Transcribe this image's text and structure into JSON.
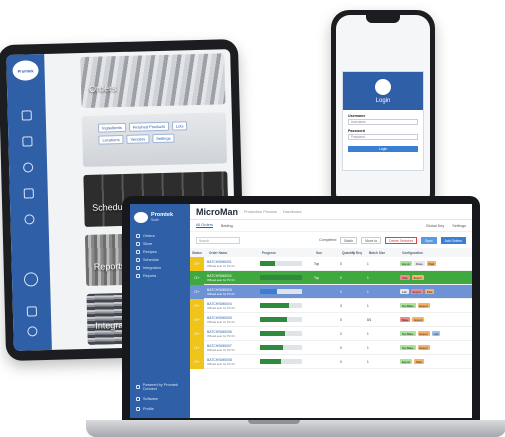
{
  "tablet": {
    "logo_text": "Promtek",
    "cards": [
      {
        "label": "Orders",
        "variant": "orders"
      },
      {
        "label": "",
        "variant": "products"
      },
      {
        "label": "Schedule",
        "variant": "schedule"
      },
      {
        "label": "Reports",
        "variant": "reports"
      },
      {
        "label": "Integrations",
        "variant": "integrations"
      }
    ],
    "product_chips": [
      "Ingredients",
      "Finished Products",
      "Lots",
      "Locations",
      "Vendors",
      "Settings"
    ],
    "side_icons": [
      "clipboard-icon",
      "list-icon",
      "layers-icon",
      "calendar-icon",
      "network-icon"
    ],
    "bottom_icons": [
      "logout-icon",
      "settings-icon"
    ]
  },
  "phone": {
    "login_title": "Login",
    "username_label": "Username",
    "username_placeholder": "Username",
    "password_label": "Password",
    "password_placeholder": "Password",
    "login_button": "Login"
  },
  "laptop": {
    "brand": "Promtek",
    "brand_sub": "Suite",
    "app_title": "MicroMan",
    "breadcrumb": [
      "Production Process",
      "Dashboard"
    ],
    "nav": [
      "Orders",
      "Store",
      "Recipes",
      "Schedule",
      "Integration",
      "Reports"
    ],
    "footer_nav": [
      "Powered by Promtek Connect",
      "Software",
      "Profile"
    ],
    "tabs": [
      "All Orders",
      "Batting"
    ],
    "tabs_right": [
      "Global Key",
      "Settings"
    ],
    "toolbar": {
      "search_placeholder": "Search",
      "filter_label": "Completed",
      "btn_batch": "Batch",
      "btn_move": "Move to",
      "btn_delete": "Delete Selected",
      "btn_sync": "Sync",
      "btn_add": "Add Orders"
    },
    "columns": [
      "Status",
      "Order Name",
      "Progress",
      "Sun",
      "Quantity",
      "% Req",
      "Batch Size",
      "Configuration"
    ],
    "rows": [
      {
        "status": "O+",
        "name": "BATCHSIM0001",
        "sub": "Offload auto for PU 01",
        "progress": 0.35,
        "row": "",
        "fill": "green",
        "tags": [
          "Export",
          "Rose",
          "Paid"
        ],
        "tagc": [
          "g",
          "w",
          "o"
        ],
        "sun": "Top",
        "qty": "0",
        "batch": "1"
      },
      {
        "status": "O+",
        "name": "BATCHSIM0002",
        "sub": "Offload auto for PU 01",
        "progress": 1.0,
        "row": "green",
        "fill": "green",
        "tags": [
          "Ship",
          "Export"
        ],
        "tagc": [
          "r",
          "o"
        ],
        "sun": "Top",
        "qty": "0",
        "batch": "1"
      },
      {
        "status": "O+",
        "name": "BATCHSIM0003",
        "sub": "Offload auto for PU 01",
        "progress": 0.4,
        "row": "blue",
        "fill": "blue",
        "tags": [
          "Lab",
          "Export",
          "Paid"
        ],
        "tagc": [
          "w",
          "r",
          "o"
        ],
        "sun": "",
        "qty": "0",
        "batch": "1"
      },
      {
        "status": "O+",
        "name": "BATCHSIM0004",
        "sub": "Offload auto for PU 01",
        "progress": 0.7,
        "row": "",
        "fill": "green",
        "tags": [
          "Not Bake",
          "Export"
        ],
        "tagc": [
          "g",
          "o"
        ],
        "sun": "",
        "qty": "3",
        "batch": "1"
      },
      {
        "status": "O+",
        "name": "BATCHSIM0005",
        "sub": "Offload auto for PU 01",
        "progress": 0.65,
        "row": "",
        "fill": "green",
        "tags": [
          "Bake",
          "Export"
        ],
        "tagc": [
          "r",
          "o"
        ],
        "sun": "",
        "qty": "0",
        "batch": "8/1"
      },
      {
        "status": "O+",
        "name": "BATCHSIM0006",
        "sub": "Offload auto for PU 01",
        "progress": 0.6,
        "row": "",
        "fill": "green",
        "tags": [
          "Not Bake",
          "Export",
          "Lab"
        ],
        "tagc": [
          "g",
          "o",
          "b"
        ],
        "sun": "",
        "qty": "2",
        "batch": "1"
      },
      {
        "status": "O+",
        "name": "BATCHSIM0007",
        "sub": "Offload auto for PU 01",
        "progress": 0.55,
        "row": "",
        "fill": "green",
        "tags": [
          "Not Bake",
          "Export"
        ],
        "tagc": [
          "g",
          "o"
        ],
        "sun": "",
        "qty": "0",
        "batch": "1"
      },
      {
        "status": "O+",
        "name": "BATCHSIM0008",
        "sub": "Offload auto for PU 01",
        "progress": 0.5,
        "row": "",
        "fill": "green",
        "tags": [
          "Export",
          "Paid"
        ],
        "tagc": [
          "g",
          "o"
        ],
        "sun": "",
        "qty": "0",
        "batch": "1"
      }
    ],
    "status_colors": {
      "default": "#f0c419",
      "green": "#3fa83f",
      "blue": "#6e92d6"
    }
  }
}
